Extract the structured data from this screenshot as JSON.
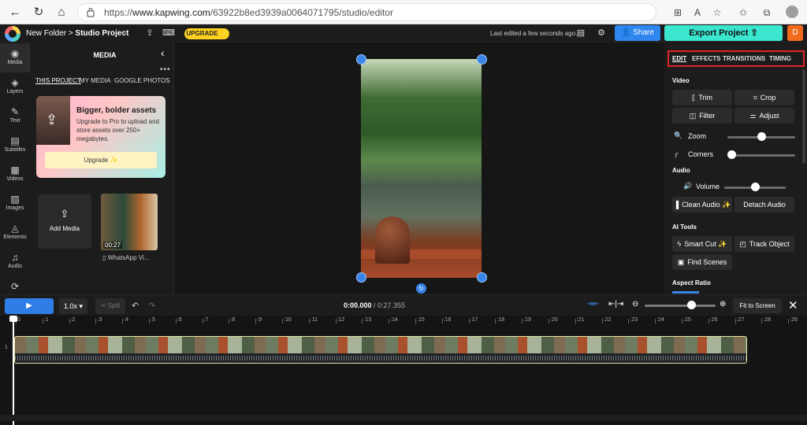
{
  "browser": {
    "url_prefix": "https://",
    "url_host": "www.kapwing.com",
    "url_path": "/63922b8ed3939a0064071795/studio/editor",
    "nav_icons": [
      "back-arrow-icon",
      "refresh-icon",
      "home-icon"
    ],
    "toolbar_icons": [
      "apps-icon",
      "read-aloud-icon",
      "favorite-add-icon",
      "favorites-icon",
      "collections-icon",
      "profile-icon"
    ]
  },
  "header": {
    "folder": "New Folder",
    "separator": ">",
    "project": "Studio Project",
    "upgrade": "UPGRADE ✨",
    "last_edited": "Last edited a few seconds ago.",
    "share": "Share",
    "export": "Export Project",
    "avatar_letter": "D",
    "colors": {
      "share": "#2f86ef",
      "export": "#3be6cf",
      "upgrade": "#ffd21e",
      "avatar": "#f26b1d"
    }
  },
  "rail": [
    {
      "label": "Media",
      "icon": "media-icon"
    },
    {
      "label": "Layers",
      "icon": "layers-icon"
    },
    {
      "label": "Text",
      "icon": "text-icon"
    },
    {
      "label": "Subtitles",
      "icon": "subtitles-icon"
    },
    {
      "label": "Videos",
      "icon": "videos-icon"
    },
    {
      "label": "Images",
      "icon": "images-icon"
    },
    {
      "label": "Elements",
      "icon": "elements-icon"
    },
    {
      "label": "Audio",
      "icon": "audio-icon"
    },
    {
      "label": "",
      "icon": "transitions-icon"
    }
  ],
  "media": {
    "title": "MEDIA",
    "tabs": [
      "THIS PROJECT",
      "MY MEDIA",
      "GOOGLE PHOTOS"
    ],
    "promo_title": "Bigger, bolder assets",
    "promo_text": "Upgrade to Pro to upload and store assets over 250+ megabytes.",
    "promo_button": "Upgrade ✨",
    "add_media": "Add Media",
    "thumb_duration": "00:27",
    "thumb_name": "WhatsApp Vi..."
  },
  "right_panel": {
    "tabs": [
      "EDIT",
      "EFFECTS",
      "TRANSITIONS",
      "TIMING"
    ],
    "video_label": "Video",
    "trim": "Trim",
    "crop": "Crop",
    "filter": "Filter",
    "adjust": "Adjust",
    "zoom": "Zoom",
    "corners": "Corners",
    "audio_label": "Audio",
    "volume": "Volume",
    "clean_audio": "Clean Audio ✨",
    "detach_audio": "Detach Audio",
    "ai_tools_label": "AI Tools",
    "smart_cut": "Smart Cut ✨",
    "track_object": "Track Object",
    "find_scenes": "Find Scenes",
    "aspect_ratio_label": "Aspect Ratio",
    "zoom_level": 0.5,
    "corners_level": 0.0,
    "volume_level": 0.5
  },
  "playback": {
    "speed": "1.0x",
    "split": "Split",
    "current_time": "0:00.000",
    "total_time": "/ 0:27.355",
    "fit": "Fit to Screen",
    "timeline_zoom": 0.6
  },
  "timeline": {
    "ticks": [
      "0",
      ":1",
      ":2",
      ":3",
      ":4",
      ":5",
      ":6",
      ":7",
      ":8",
      ":9",
      ":10",
      ":11",
      ":12",
      ":13",
      ":14",
      ":15",
      ":16",
      ":17",
      ":18",
      ":19",
      ":20",
      ":21",
      ":22",
      ":23",
      ":24",
      ":25",
      ":26",
      ":27",
      ":28",
      ":29"
    ],
    "track_number": "1"
  }
}
